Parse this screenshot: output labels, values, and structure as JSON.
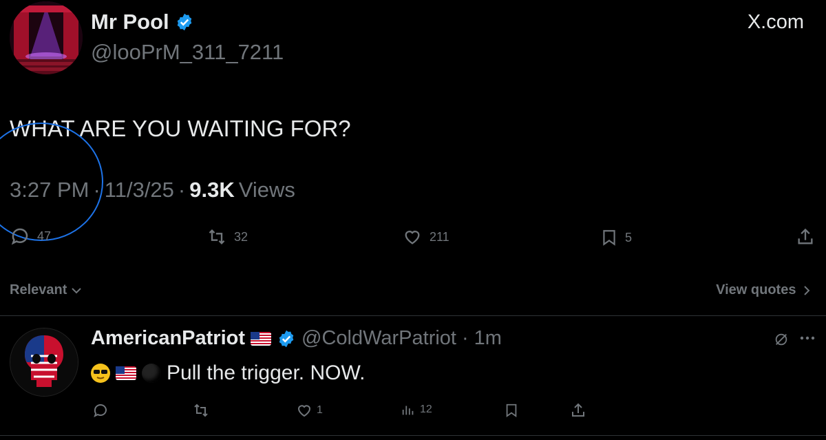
{
  "tweet": {
    "author_name": "Mr Pool",
    "author_handle": "@looPrM_311_7211",
    "site_label": "X.com",
    "text": "WHAT ARE YOU WAITING FOR?",
    "time": "3:27 PM",
    "sep1": "·",
    "date": "11/3/25",
    "sep2": "·",
    "views_count": "9.3K",
    "views_label": "Views",
    "replies": "47",
    "reposts": "32",
    "likes": "211",
    "bookmarks": "5"
  },
  "filter": {
    "relevant_label": "Relevant",
    "view_quotes_label": "View quotes"
  },
  "reply": {
    "author_name": "AmericanPatriot",
    "author_handle": "@ColdWarPatriot",
    "sep": "·",
    "time": "1m",
    "text": "Pull the trigger. NOW.",
    "replies": "",
    "reposts": "",
    "likes": "1",
    "views": "12"
  },
  "colors": {
    "background": "#000000",
    "primary_text": "#e7e9ea",
    "secondary_text": "#71767b",
    "verified": "#1d9bf0",
    "annotation_circle": "#1d73e8"
  },
  "icons": [
    "verified-badge-icon",
    "reply-icon",
    "repost-icon",
    "like-icon",
    "bookmark-icon",
    "share-icon",
    "views-icon",
    "chevron-down-icon",
    "chevron-right-icon",
    "more-icon",
    "grok-icon"
  ]
}
